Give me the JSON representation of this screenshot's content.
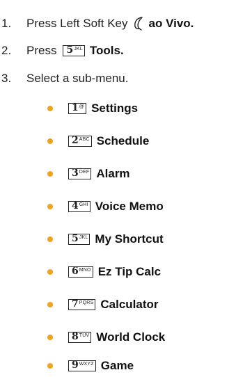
{
  "steps": [
    {
      "number": "1.",
      "text": "Press Left Soft Key",
      "icon": "left-soft-key-icon",
      "label": "ao Vivo."
    },
    {
      "number": "2.",
      "text": "Press",
      "key_digit": "5",
      "key_letters": "JKL",
      "label": "Tools."
    },
    {
      "number": "3.",
      "text": "Select a sub-menu."
    }
  ],
  "submenu": [
    {
      "key_digit": "1",
      "key_letters": "@",
      "label": "Settings"
    },
    {
      "key_digit": "2",
      "key_letters": "ABC",
      "label": "Schedule"
    },
    {
      "key_digit": "3",
      "key_letters": "DEF",
      "label": "Alarm"
    },
    {
      "key_digit": "4",
      "key_letters": "GHI",
      "label": "Voice Memo"
    },
    {
      "key_digit": "5",
      "key_letters": "JKL",
      "label": "My Shortcut"
    },
    {
      "key_digit": "6",
      "key_letters": "MNO",
      "label": "Ez Tip Calc"
    },
    {
      "key_digit": "7",
      "key_letters": "PQRS",
      "label": "Calculator"
    },
    {
      "key_digit": "8",
      "key_letters": "TUV",
      "label": "World Clock"
    },
    {
      "key_digit": "9",
      "key_letters": "WXYZ",
      "label": "Game"
    }
  ],
  "colors": {
    "bullet": "#f0a31e",
    "text": "#222222"
  }
}
